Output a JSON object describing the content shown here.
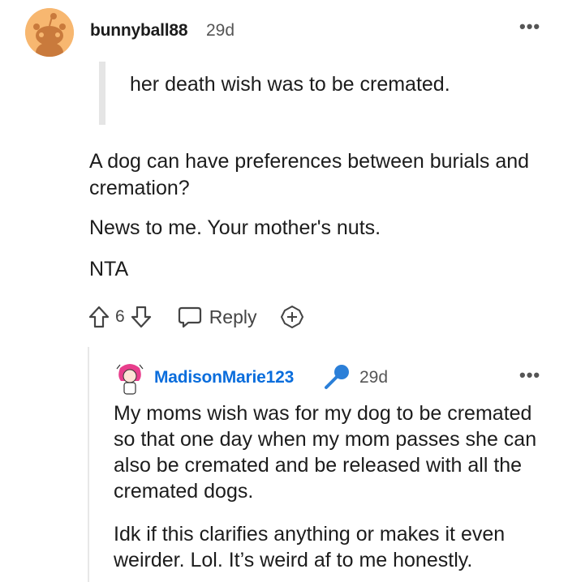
{
  "comment": {
    "username": "bunnyball88",
    "time": "29d",
    "more": "•••",
    "quote": "her death wish was to be cremated.",
    "paragraphs": [
      "A dog can have preferences between burials and cremation?",
      "News to me. Your mother's nuts.",
      "NTA"
    ],
    "votes": "6",
    "reply_label": "Reply"
  },
  "reply": {
    "username": "MadisonMarie123",
    "time": "29d",
    "more": "•••",
    "paragraphs": [
      "My moms wish was for my dog to be cremated so that one day when my mom passes she can also be cremated and be released with all the cremated dogs.",
      "Idk if this clarifies anything or makes it even weirder. Lol. It’s weird af to me honestly."
    ]
  },
  "colors": {
    "avatar_bg": "#f7b770",
    "reply_username": "#0a6ddc",
    "mic_icon": "#2b7fd8"
  }
}
